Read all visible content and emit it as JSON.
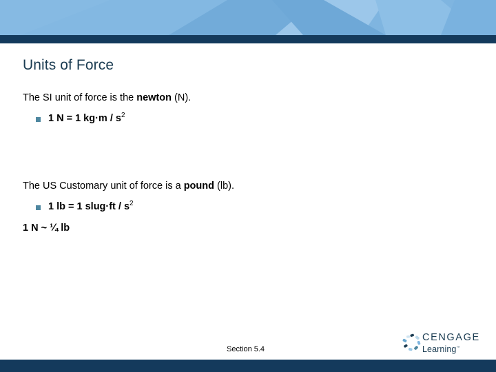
{
  "slide": {
    "title": "Units of Force",
    "section_label": "Section 5.4",
    "body": {
      "para1_pre": "The SI unit of force is the ",
      "para1_bold": "newton",
      "para1_post": " (N).",
      "bullet1_main": "1 N = 1 kg·m / s",
      "bullet1_sup": "2",
      "para2_pre": "The US Customary unit of force is a ",
      "para2_bold": "pound",
      "para2_post": " (lb).",
      "bullet2_main": "1 lb = 1 slug·ft / s",
      "bullet2_sup": "2",
      "note": "1 N ~ ¼ lb"
    }
  },
  "logo": {
    "word": "CENGAGE",
    "sub": "Learning",
    "tm": "™"
  },
  "colors": {
    "header_blue": "#7fb5e0",
    "header_blue_light": "#93c2e7",
    "header_blue_dark": "#6fa9d8",
    "navy": "#143a5c",
    "title_navy": "#1b3c52",
    "bullet_teal": "#4e87a0",
    "body_black": "#000000"
  }
}
